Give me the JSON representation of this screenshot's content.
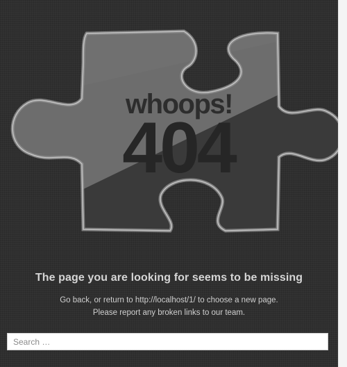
{
  "error": {
    "whoops_text": "whoops!",
    "code_text": "404"
  },
  "message": {
    "headline": "The page you are looking for seems to be missing",
    "line1": "Go back, or return to http://localhost/1/ to choose a new page.",
    "line2": "Please report any broken links to our team."
  },
  "search": {
    "placeholder": "Search …",
    "value": ""
  },
  "colors": {
    "background": "#2f2f2f",
    "puzzle_fill": "#6b6b6b",
    "puzzle_outline": "#a8a8a8",
    "text": "#d6d6d6"
  }
}
